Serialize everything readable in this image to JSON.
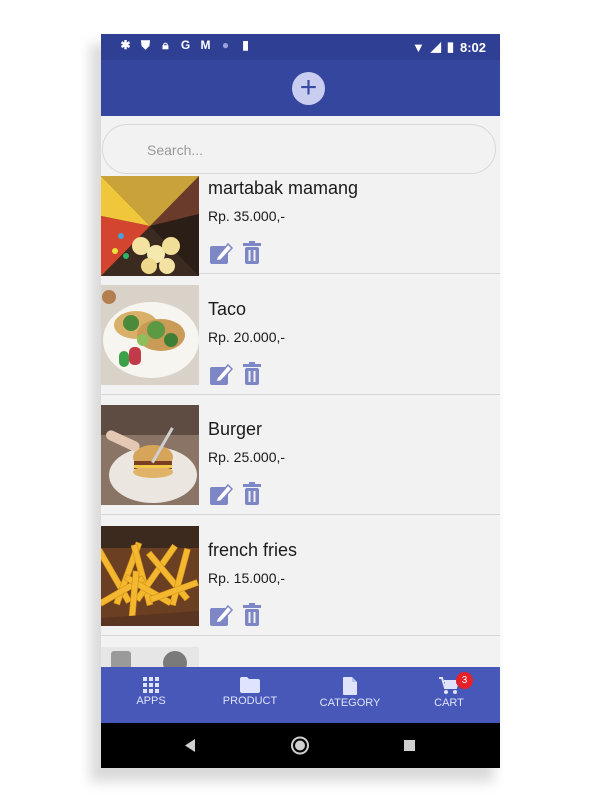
{
  "status_bar": {
    "time": "8:02",
    "left_icons": [
      "settings-icon",
      "shield-icon",
      "lock-icon",
      "google-icon",
      "gmail-icon",
      "circle-icon",
      "sd-card-icon"
    ],
    "right_icons": [
      "wifi-icon",
      "signal-icon",
      "battery-icon"
    ]
  },
  "app_bar": {
    "add_icon": "plus-circle-icon"
  },
  "search": {
    "placeholder": "Search..."
  },
  "products": [
    {
      "name": "martabak mamang",
      "price": "Rp. 35.000,-"
    },
    {
      "name": "Taco",
      "price": "Rp. 20.000,-"
    },
    {
      "name": "Burger",
      "price": "Rp. 25.000,-"
    },
    {
      "name": "french fries",
      "price": "Rp. 15.000,-"
    }
  ],
  "bottom_nav": {
    "items": [
      {
        "label": "APPS",
        "icon": "grid-icon"
      },
      {
        "label": "PRODUCT",
        "icon": "folder-icon"
      },
      {
        "label": "CATEGORY",
        "icon": "file-icon"
      },
      {
        "label": "CART",
        "icon": "cart-icon"
      }
    ],
    "cart_badge": "3"
  },
  "colors": {
    "status_bar": "#2f3f94",
    "app_bar": "#35469e",
    "bottom_nav": "#4758b8",
    "badge": "#e8202a",
    "action_icon": "#7d87c6"
  }
}
